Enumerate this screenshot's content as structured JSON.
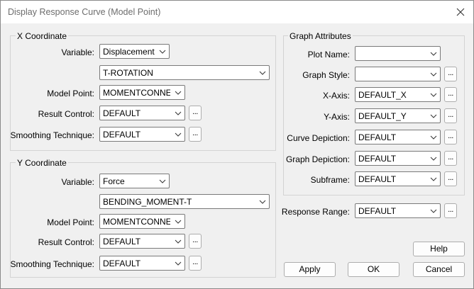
{
  "window": {
    "title": "Display Response Curve (Model Point)"
  },
  "x_coord": {
    "title": "X Coordinate",
    "variable_label": "Variable:",
    "variable_value": "Displacement",
    "component_value": "T-ROTATION",
    "model_point_label": "Model Point:",
    "model_point_value": "MOMENTCONNECTI",
    "result_control_label": "Result Control:",
    "result_control_value": "DEFAULT",
    "smoothing_label": "Smoothing Technique:",
    "smoothing_value": "DEFAULT"
  },
  "y_coord": {
    "title": "Y Coordinate",
    "variable_label": "Variable:",
    "variable_value": "Force",
    "component_value": "BENDING_MOMENT-T",
    "model_point_label": "Model Point:",
    "model_point_value": "MOMENTCONNECTI",
    "result_control_label": "Result Control:",
    "result_control_value": "DEFAULT",
    "smoothing_label": "Smoothing Technique:",
    "smoothing_value": "DEFAULT"
  },
  "graph": {
    "title": "Graph Attributes",
    "plot_name_label": "Plot Name:",
    "plot_name_value": "",
    "graph_style_label": "Graph Style:",
    "graph_style_value": "",
    "x_axis_label": "X-Axis:",
    "x_axis_value": "DEFAULT_X",
    "y_axis_label": "Y-Axis:",
    "y_axis_value": "DEFAULT_Y",
    "curve_depiction_label": "Curve Depiction:",
    "curve_depiction_value": "DEFAULT",
    "graph_depiction_label": "Graph Depiction:",
    "graph_depiction_value": "DEFAULT",
    "subframe_label": "Subframe:",
    "subframe_value": "DEFAULT"
  },
  "response_range": {
    "label": "Response Range:",
    "value": "DEFAULT"
  },
  "ellipsis": "...",
  "buttons": {
    "help": "Help",
    "apply": "Apply",
    "ok": "OK",
    "cancel": "Cancel"
  }
}
